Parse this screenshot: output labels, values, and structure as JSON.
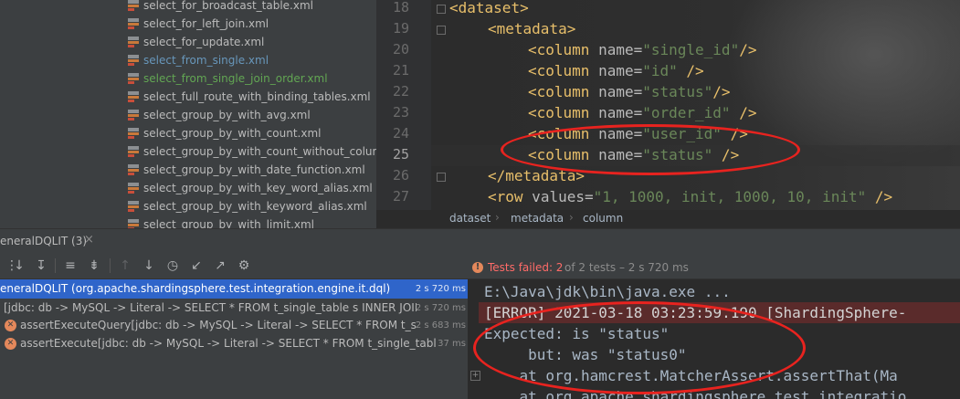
{
  "project_tree": {
    "items": [
      {
        "label": "select_for_broadcast_table.xml",
        "state": "normal"
      },
      {
        "label": "select_for_left_join.xml",
        "state": "normal"
      },
      {
        "label": "select_for_update.xml",
        "state": "normal"
      },
      {
        "label": "select_from_single.xml",
        "state": "modified"
      },
      {
        "label": "select_from_single_join_order.xml",
        "state": "added"
      },
      {
        "label": "select_full_route_with_binding_tables.xml",
        "state": "normal"
      },
      {
        "label": "select_group_by_with_avg.xml",
        "state": "normal"
      },
      {
        "label": "select_group_by_with_count.xml",
        "state": "normal"
      },
      {
        "label": "select_group_by_with_count_without_column_",
        "state": "normal"
      },
      {
        "label": "select_group_by_with_date_function.xml",
        "state": "normal"
      },
      {
        "label": "select_group_by_with_key_word_alias.xml",
        "state": "normal"
      },
      {
        "label": "select_group_by_with_keyword_alias.xml",
        "state": "normal"
      },
      {
        "label": "select_group_by_with_limit.xml",
        "state": "normal"
      }
    ]
  },
  "editor": {
    "line_numbers": [
      "18",
      "19",
      "20",
      "21",
      "22",
      "23",
      "24",
      "25",
      "26",
      "27"
    ],
    "current_line": "25",
    "lines": {
      "l18": {
        "open": "<",
        "tag": "dataset",
        "close": ">"
      },
      "l19": {
        "open": "<",
        "tag": "metadata",
        "close": ">"
      },
      "l20": {
        "open": "<",
        "tag": "column",
        "attr": " name=",
        "value": "\"single_id\"",
        "close": "/>"
      },
      "l21": {
        "open": "<",
        "tag": "column",
        "attr": " name=",
        "value": "\"id\"",
        "close": " />"
      },
      "l22": {
        "open": "<",
        "tag": "column",
        "attr": " name=",
        "value": "\"status\"",
        "close": "/>"
      },
      "l23": {
        "open": "<",
        "tag": "column",
        "attr": " name=",
        "value": "\"order_id\"",
        "close": " />"
      },
      "l24": {
        "open": "<",
        "tag": "column",
        "attr": " name=",
        "value": "\"user_id\"",
        "close": " />"
      },
      "l25": {
        "open": "<",
        "tag": "column",
        "attr": " name=",
        "value": "\"status\"",
        "close": " />"
      },
      "l26": {
        "open": "</",
        "tag": "metadata",
        "close": ">"
      },
      "l27": {
        "open": "<",
        "tag": "row",
        "attr": " values=",
        "value": "\"1, 1000, init, 1000, 10, init\"",
        "close": " />"
      }
    }
  },
  "breadcrumbs": [
    "dataset",
    "metadata",
    "column"
  ],
  "run_panel": {
    "tab_title": "eneralDQLIT (3)",
    "close_glyph": "×",
    "status": {
      "failed_text": "Tests failed: 2",
      "rest_text": "of 2 tests – 2 s 720 ms"
    },
    "tests": [
      {
        "label": "eneralDQLIT (org.apache.shardingsphere.test.integration.engine.it.dql)",
        "duration": "2 s 720 ms",
        "selected": true
      },
      {
        "label": "[jdbc: db -> MySQL -> Literal -> SELECT * FROM t_single_table s INNER JOIN",
        "duration": "2 s 720 ms",
        "selected": false
      },
      {
        "label": "assertExecuteQuery[jdbc: db -> MySQL -> Literal -> SELECT * FROM t_sing",
        "duration": "2 s 683 ms",
        "selected": false
      },
      {
        "label": "assertExecute[jdbc: db -> MySQL -> Literal -> SELECT * FROM t_single_table s",
        "duration": "37 ms",
        "selected": false
      }
    ]
  },
  "console": {
    "lines": [
      "E:\\Java\\jdk\\bin\\java.exe ...",
      "[ERROR] 2021-03-18 03:23:59.190 [ShardingSphere-",
      "Expected: is \"status\"",
      "     but: was \"status0\"",
      "    at org.hamcrest.MatcherAssert.assertThat(Ma",
      "    at org.apache.shardingsphere.test.integratio"
    ]
  },
  "colors": {
    "annotation": "#e8231f",
    "error_text": "#ff6b68",
    "selection": "#2f65ca"
  }
}
